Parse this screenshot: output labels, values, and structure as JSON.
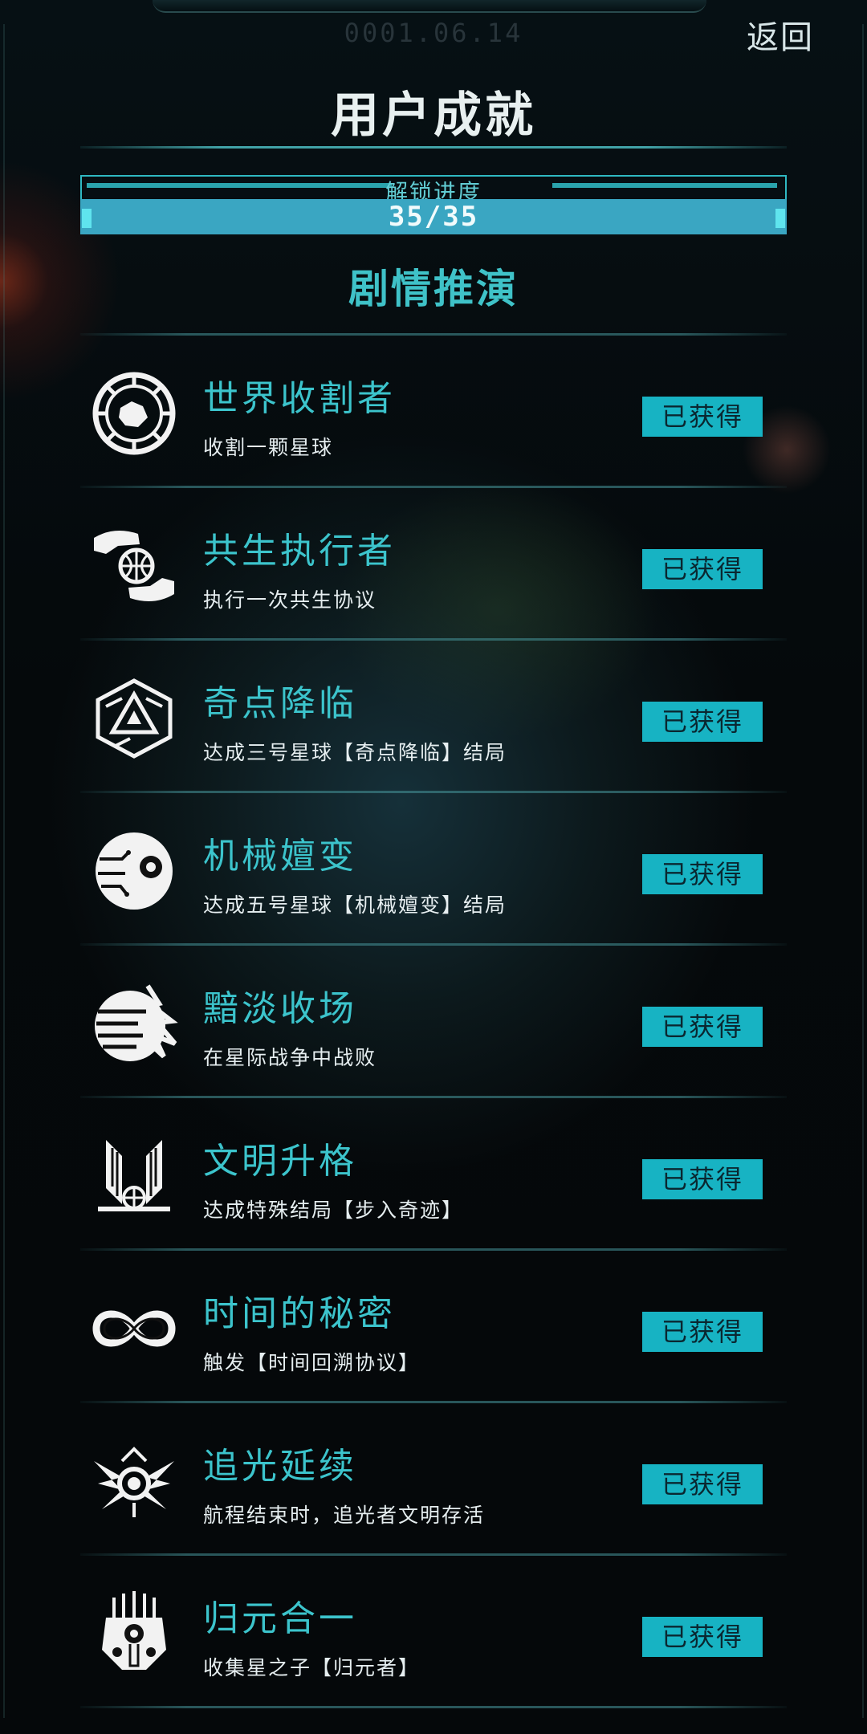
{
  "header": {
    "date": "0001.06.14",
    "back_label": "返回",
    "title": "用户成就"
  },
  "progress": {
    "label": "解锁进度",
    "text": "35/35",
    "fraction": 1.0
  },
  "section": {
    "title": "剧情推演"
  },
  "colors": {
    "accent": "#3cc4cc",
    "badge": "#17b3c3",
    "background": "#05090b"
  },
  "achievements": [
    {
      "icon": "planet-harvest-icon",
      "name": "世界收割者",
      "desc": "收割一颗星球",
      "status": "已获得"
    },
    {
      "icon": "hands-globe-icon",
      "name": "共生执行者",
      "desc": "执行一次共生协议",
      "status": "已获得"
    },
    {
      "icon": "triangle-emblem-icon",
      "name": "奇点降临",
      "desc": "达成三号星球【奇点降临】结局",
      "status": "已获得"
    },
    {
      "icon": "mechanical-eye-icon",
      "name": "机械嬗变",
      "desc": "达成五号星球【机械嬗变】结局",
      "status": "已获得"
    },
    {
      "icon": "shattered-planet-icon",
      "name": "黯淡收场",
      "desc": "在星际战争中战败",
      "status": "已获得"
    },
    {
      "icon": "winged-emblem-icon",
      "name": "文明升格",
      "desc": "达成特殊结局【步入奇迹】",
      "status": "已获得"
    },
    {
      "icon": "infinity-icon",
      "name": "时间的秘密",
      "desc": "触发【时间回溯协议】",
      "status": "已获得"
    },
    {
      "icon": "winged-orb-icon",
      "name": "追光延续",
      "desc": "航程结束时，追光者文明存活",
      "status": "已获得"
    },
    {
      "icon": "robot-mask-icon",
      "name": "归元合一",
      "desc": "收集星之子【归元者】",
      "status": "已获得"
    }
  ]
}
